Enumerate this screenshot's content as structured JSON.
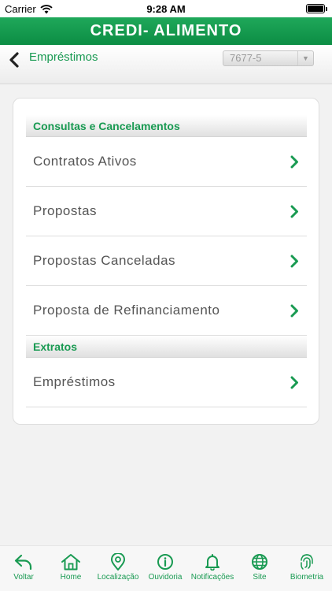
{
  "status_bar": {
    "carrier": "Carrier",
    "time": "9:28 AM"
  },
  "app": {
    "title": "CREDI- ALIMENTO"
  },
  "nav": {
    "title": "Empréstimos",
    "account": "7677-5"
  },
  "sections": [
    {
      "title": "Consultas e Cancelamentos",
      "items": [
        "Contratos Ativos",
        "Propostas",
        "Propostas Canceladas",
        "Proposta de Refinanciamento"
      ]
    },
    {
      "title": "Extratos",
      "items": [
        "Empréstimos"
      ]
    }
  ],
  "tabs": [
    "Voltar",
    "Home",
    "Localização",
    "Ouvidoria",
    "Notificações",
    "Site",
    "Biometria"
  ],
  "colors": {
    "brand_green": "#199a52",
    "text_gray": "#555555"
  }
}
